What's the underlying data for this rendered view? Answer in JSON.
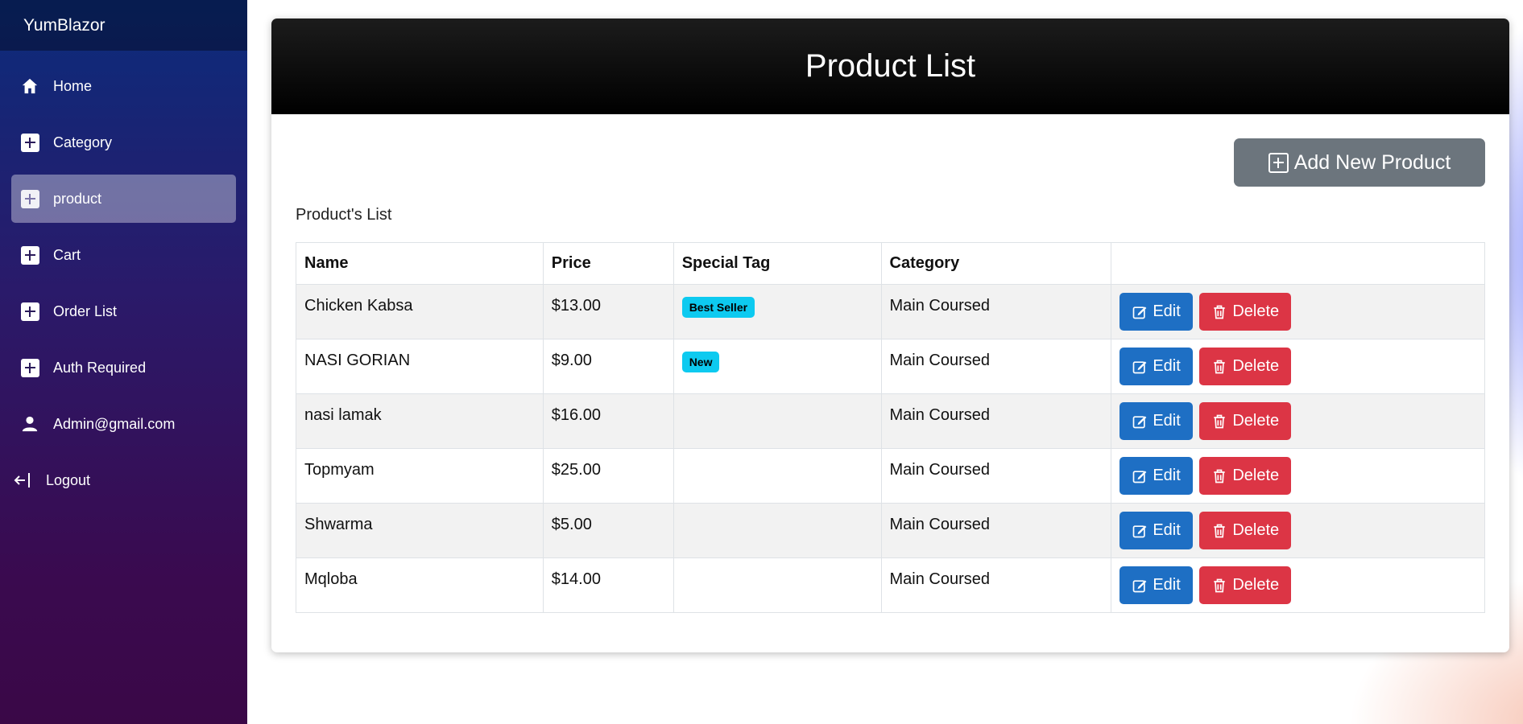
{
  "app": {
    "brand": "YumBlazor"
  },
  "sidebar": {
    "items": [
      {
        "label": "Home",
        "icon": "home-icon"
      },
      {
        "label": "Category",
        "icon": "plus-square-icon"
      },
      {
        "label": "product",
        "icon": "plus-square-icon",
        "active": true
      },
      {
        "label": "Cart",
        "icon": "plus-square-icon"
      },
      {
        "label": "Order List",
        "icon": "plus-square-icon"
      },
      {
        "label": "Auth Required",
        "icon": "plus-square-icon"
      },
      {
        "label": "Admin@gmail.com",
        "icon": "person-icon"
      },
      {
        "label": "Logout",
        "icon": "logout-icon"
      }
    ]
  },
  "main": {
    "title": "Product List",
    "add_button_label": "Add New Product",
    "list_label": "Product's List",
    "table": {
      "columns": [
        "Name",
        "Price",
        "Special Tag",
        "Category",
        ""
      ],
      "rows": [
        {
          "name": "Chicken Kabsa",
          "price": "$13.00",
          "tag": "Best Seller",
          "category": "Main Coursed"
        },
        {
          "name": "NASI GORIAN",
          "price": "$9.00",
          "tag": "New",
          "category": "Main Coursed"
        },
        {
          "name": "nasi lamak",
          "price": "$16.00",
          "tag": "",
          "category": "Main Coursed"
        },
        {
          "name": "Topmyam",
          "price": "$25.00",
          "tag": "",
          "category": "Main Coursed"
        },
        {
          "name": "Shwarma",
          "price": "$5.00",
          "tag": "",
          "category": "Main Coursed"
        },
        {
          "name": "Mqloba",
          "price": "$14.00",
          "tag": "",
          "category": "Main Coursed"
        }
      ],
      "edit_label": "Edit",
      "delete_label": "Delete"
    }
  },
  "colors": {
    "edit": "#1e6fc4",
    "delete": "#dc3545",
    "badge": "#0dcaf0",
    "add_button": "#6c757d"
  }
}
